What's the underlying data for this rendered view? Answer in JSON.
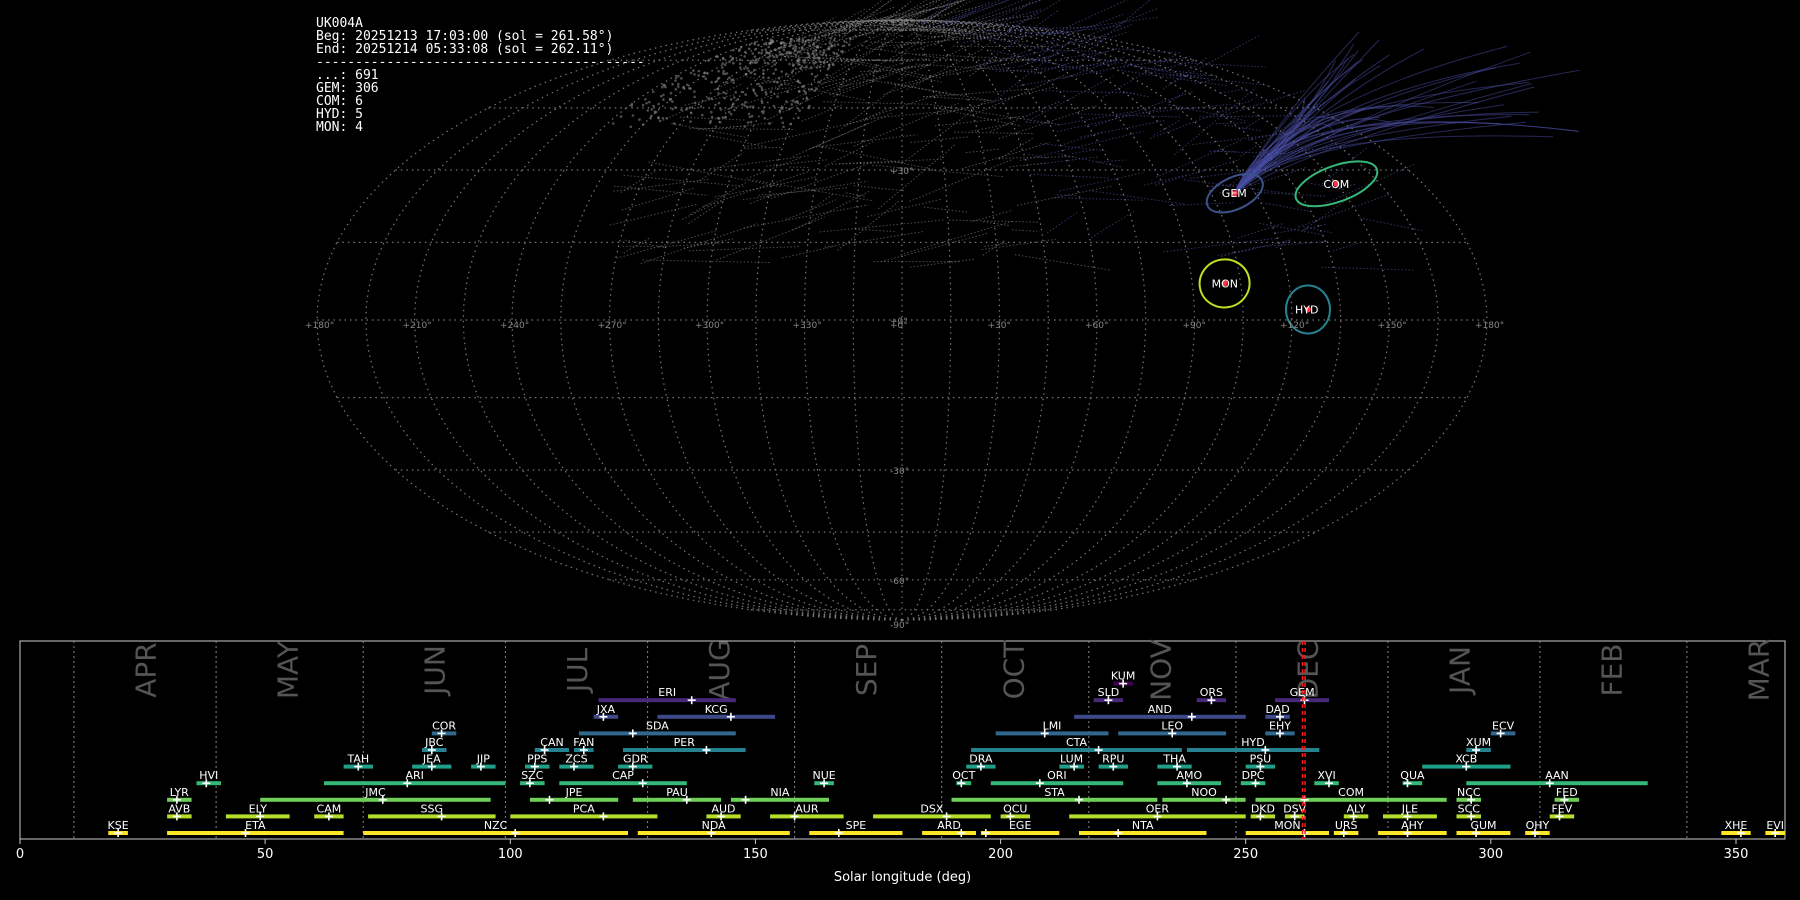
{
  "info": {
    "station": "UK004A",
    "begin": "Beg: 20251213 17:03:00 (sol = 261.58°)",
    "end": "End: 20251214 05:33:08 (sol = 262.11°)",
    "separator": "------------------------------------------",
    "counts": [
      {
        "code": "...",
        "n": 691
      },
      {
        "code": "GEM",
        "n": 306
      },
      {
        "code": "COM",
        "n": 6
      },
      {
        "code": "HYD",
        "n": 5
      },
      {
        "code": "MON",
        "n": 4
      }
    ]
  },
  "chart_data": [
    {
      "type": "scatter",
      "projection": "sinusoidal-skymap",
      "grid": true,
      "lon_ticks": [
        "+180°",
        "+150°",
        "+120°",
        "+90°",
        "+60°",
        "+30°",
        "+0°",
        "+330°",
        "+300°",
        "+270°",
        "+240°",
        "+210°",
        "+180°"
      ],
      "lat_ticks": [
        "+90°",
        "+30°",
        "+0°",
        "-30°",
        "-60°",
        "-90°"
      ],
      "showers": [
        {
          "code": "COM",
          "lon": 150,
          "lat": 27,
          "color": "#35b779"
        },
        {
          "code": "GEM",
          "lon": 113,
          "lat": 25,
          "color": "#3b528b"
        },
        {
          "code": "MON",
          "lon": 100,
          "lat": 7,
          "color": "#c2df23"
        },
        {
          "code": "HYD",
          "lon": 125,
          "lat": 2,
          "color": "#26828e"
        }
      ]
    },
    {
      "type": "bar",
      "title": "",
      "xlabel": "Solar longitude (deg)",
      "ylabel": "",
      "xlim": [
        0,
        360
      ],
      "x_ticks": [
        0,
        50,
        100,
        150,
        200,
        250,
        300,
        350
      ],
      "months": [
        {
          "label": "APR",
          "start": 11
        },
        {
          "label": "MAY",
          "start": 40
        },
        {
          "label": "JUN",
          "start": 70
        },
        {
          "label": "JUL",
          "start": 99
        },
        {
          "label": "AUG",
          "start": 128
        },
        {
          "label": "SEP",
          "start": 158
        },
        {
          "label": "OCT",
          "start": 188
        },
        {
          "label": "NOV",
          "start": 218
        },
        {
          "label": "DEC",
          "start": 248
        },
        {
          "label": "JAN",
          "start": 279
        },
        {
          "label": "FEB",
          "start": 310
        },
        {
          "label": "MAR",
          "start": 340
        }
      ],
      "observation_window": [
        261.58,
        262.11
      ],
      "showers": [
        {
          "code": "KUM",
          "start": 223,
          "end": 227,
          "peak": 225,
          "row": 10
        },
        {
          "code": "SLD",
          "start": 219,
          "end": 225,
          "peak": 222,
          "row": 9
        },
        {
          "code": "ORS",
          "start": 240,
          "end": 246,
          "peak": 243,
          "row": 9
        },
        {
          "code": "GEM",
          "start": 256,
          "end": 267,
          "peak": 262,
          "row": 9
        },
        {
          "code": "ERI",
          "start": 118,
          "end": 146,
          "peak": 137,
          "row": 9
        },
        {
          "code": "JXA",
          "start": 117,
          "end": 122,
          "peak": 119,
          "row": 8
        },
        {
          "code": "KCG",
          "start": 130,
          "end": 154,
          "peak": 145,
          "row": 8
        },
        {
          "code": "AND",
          "start": 215,
          "end": 250,
          "peak": 239,
          "row": 8
        },
        {
          "code": "DAD",
          "start": 254,
          "end": 259,
          "peak": 257,
          "row": 8
        },
        {
          "code": "COR",
          "start": 84,
          "end": 89,
          "peak": 86,
          "row": 7
        },
        {
          "code": "SDA",
          "start": 114,
          "end": 146,
          "peak": 125,
          "row": 7
        },
        {
          "code": "LMI",
          "start": 199,
          "end": 222,
          "peak": 209,
          "row": 7
        },
        {
          "code": "LEO",
          "start": 224,
          "end": 246,
          "peak": 235,
          "row": 7
        },
        {
          "code": "EHY",
          "start": 254,
          "end": 260,
          "peak": 257,
          "row": 7
        },
        {
          "code": "ECV",
          "start": 300,
          "end": 305,
          "peak": 302,
          "row": 7
        },
        {
          "code": "JBC",
          "start": 82,
          "end": 87,
          "peak": 84,
          "row": 6
        },
        {
          "code": "CAN",
          "start": 105,
          "end": 112,
          "peak": 107,
          "row": 6
        },
        {
          "code": "FAN",
          "start": 113,
          "end": 117,
          "peak": 115,
          "row": 6
        },
        {
          "code": "PER",
          "start": 123,
          "end": 148,
          "peak": 140,
          "row": 6
        },
        {
          "code": "CTA",
          "start": 194,
          "end": 237,
          "peak": 220,
          "row": 6
        },
        {
          "code": "HYD",
          "start": 238,
          "end": 265,
          "peak": 254,
          "row": 6
        },
        {
          "code": "XUM",
          "start": 295,
          "end": 300,
          "peak": 297,
          "row": 6
        },
        {
          "code": "TAH",
          "start": 66,
          "end": 72,
          "peak": 69,
          "row": 5
        },
        {
          "code": "JEA",
          "start": 80,
          "end": 88,
          "peak": 84,
          "row": 5
        },
        {
          "code": "JIP",
          "start": 92,
          "end": 97,
          "peak": 94,
          "row": 5
        },
        {
          "code": "PPS",
          "start": 103,
          "end": 108,
          "peak": 105,
          "row": 5
        },
        {
          "code": "ZCS",
          "start": 110,
          "end": 117,
          "peak": 113,
          "row": 5
        },
        {
          "code": "GDR",
          "start": 122,
          "end": 129,
          "peak": 125,
          "row": 5
        },
        {
          "code": "DRA",
          "start": 193,
          "end": 199,
          "peak": 196,
          "row": 5
        },
        {
          "code": "LUM",
          "start": 212,
          "end": 217,
          "peak": 215,
          "row": 5
        },
        {
          "code": "RPU",
          "start": 220,
          "end": 226,
          "peak": 223,
          "row": 5
        },
        {
          "code": "THA",
          "start": 232,
          "end": 239,
          "peak": 236,
          "row": 5
        },
        {
          "code": "PSU",
          "start": 250,
          "end": 256,
          "peak": 253,
          "row": 5
        },
        {
          "code": "XCB",
          "start": 286,
          "end": 304,
          "peak": 295,
          "row": 5
        },
        {
          "code": "HVI",
          "start": 36,
          "end": 41,
          "peak": 38,
          "row": 4
        },
        {
          "code": "ARI",
          "start": 62,
          "end": 99,
          "peak": 79,
          "row": 4
        },
        {
          "code": "SZC",
          "start": 102,
          "end": 107,
          "peak": 104,
          "row": 4
        },
        {
          "code": "CAP",
          "start": 110,
          "end": 136,
          "peak": 127,
          "row": 4
        },
        {
          "code": "NUE",
          "start": 162,
          "end": 166,
          "peak": 164,
          "row": 4
        },
        {
          "code": "OCT",
          "start": 191,
          "end": 194,
          "peak": 192,
          "row": 4
        },
        {
          "code": "ORI",
          "start": 198,
          "end": 225,
          "peak": 208,
          "row": 4
        },
        {
          "code": "AMO",
          "start": 232,
          "end": 245,
          "peak": 238,
          "row": 4
        },
        {
          "code": "DPC",
          "start": 249,
          "end": 254,
          "peak": 252,
          "row": 4
        },
        {
          "code": "XVI",
          "start": 264,
          "end": 269,
          "peak": 267,
          "row": 4
        },
        {
          "code": "QUA",
          "start": 282,
          "end": 286,
          "peak": 283,
          "row": 4
        },
        {
          "code": "AAN",
          "start": 295,
          "end": 332,
          "peak": 312,
          "row": 4
        },
        {
          "code": "LYR",
          "start": 30,
          "end": 35,
          "peak": 32,
          "row": 3
        },
        {
          "code": "JMC",
          "start": 49,
          "end": 96,
          "peak": 74,
          "row": 3
        },
        {
          "code": "JPE",
          "start": 104,
          "end": 122,
          "peak": 108,
          "row": 3
        },
        {
          "code": "PAU",
          "start": 125,
          "end": 143,
          "peak": 136,
          "row": 3
        },
        {
          "code": "NIA",
          "start": 145,
          "end": 165,
          "peak": 148,
          "row": 3
        },
        {
          "code": "STA",
          "start": 190,
          "end": 232,
          "peak": 216,
          "row": 3
        },
        {
          "code": "NOO",
          "start": 233,
          "end": 250,
          "peak": 246,
          "row": 3
        },
        {
          "code": "COM",
          "start": 252,
          "end": 291,
          "peak": 262,
          "row": 3
        },
        {
          "code": "NCC",
          "start": 293,
          "end": 298,
          "peak": 296,
          "row": 3
        },
        {
          "code": "FED",
          "start": 313,
          "end": 318,
          "peak": 315,
          "row": 3
        },
        {
          "code": "AVB",
          "start": 30,
          "end": 35,
          "peak": 32,
          "row": 2
        },
        {
          "code": "ELY",
          "start": 42,
          "end": 55,
          "peak": 49,
          "row": 2
        },
        {
          "code": "CAM",
          "start": 60,
          "end": 66,
          "peak": 63,
          "row": 2
        },
        {
          "code": "SSG",
          "start": 71,
          "end": 97,
          "peak": 86,
          "row": 2
        },
        {
          "code": "PCA",
          "start": 100,
          "end": 130,
          "peak": 119,
          "row": 2
        },
        {
          "code": "AUD",
          "start": 140,
          "end": 147,
          "peak": 143,
          "row": 2
        },
        {
          "code": "AUR",
          "start": 153,
          "end": 168,
          "peak": 158,
          "row": 2
        },
        {
          "code": "DSX",
          "start": 174,
          "end": 198,
          "peak": 189,
          "row": 2
        },
        {
          "code": "OCU",
          "start": 200,
          "end": 206,
          "peak": 202,
          "row": 2
        },
        {
          "code": "OER",
          "start": 214,
          "end": 250,
          "peak": 232,
          "row": 2
        },
        {
          "code": "DKD",
          "start": 251,
          "end": 256,
          "peak": 253,
          "row": 2
        },
        {
          "code": "DSV",
          "start": 258,
          "end": 262,
          "peak": 260,
          "row": 2
        },
        {
          "code": "ALY",
          "start": 270,
          "end": 275,
          "peak": 272,
          "row": 2
        },
        {
          "code": "JLE",
          "start": 278,
          "end": 289,
          "peak": 283,
          "row": 2
        },
        {
          "code": "SCC",
          "start": 293,
          "end": 298,
          "peak": 296,
          "row": 2
        },
        {
          "code": "FEV",
          "start": 312,
          "end": 317,
          "peak": 314,
          "row": 2
        },
        {
          "code": "KSE",
          "start": 18,
          "end": 22,
          "peak": 20,
          "row": 1
        },
        {
          "code": "ETA",
          "start": 30,
          "end": 66,
          "peak": 46,
          "row": 1
        },
        {
          "code": "NZC",
          "start": 70,
          "end": 124,
          "peak": 101,
          "row": 1
        },
        {
          "code": "NDA",
          "start": 126,
          "end": 157,
          "peak": 141,
          "row": 1
        },
        {
          "code": "SPE",
          "start": 161,
          "end": 180,
          "peak": 167,
          "row": 1
        },
        {
          "code": "ARD",
          "start": 184,
          "end": 195,
          "peak": 192,
          "row": 1
        },
        {
          "code": "EGE",
          "start": 196,
          "end": 212,
          "peak": 197,
          "row": 1
        },
        {
          "code": "NTA",
          "start": 216,
          "end": 242,
          "peak": 224,
          "row": 1
        },
        {
          "code": "MON",
          "start": 250,
          "end": 267,
          "peak": 262,
          "row": 1
        },
        {
          "code": "URS",
          "start": 268,
          "end": 273,
          "peak": 270,
          "row": 1
        },
        {
          "code": "AHY",
          "start": 277,
          "end": 291,
          "peak": 283,
          "row": 1
        },
        {
          "code": "GUM",
          "start": 293,
          "end": 304,
          "peak": 297,
          "row": 1
        },
        {
          "code": "OHY",
          "start": 307,
          "end": 312,
          "peak": 309,
          "row": 1
        },
        {
          "code": "XHE",
          "start": 347,
          "end": 353,
          "peak": 351,
          "row": 1
        },
        {
          "code": "EVI",
          "start": 356,
          "end": 360,
          "peak": 358,
          "row": 1
        }
      ]
    }
  ]
}
